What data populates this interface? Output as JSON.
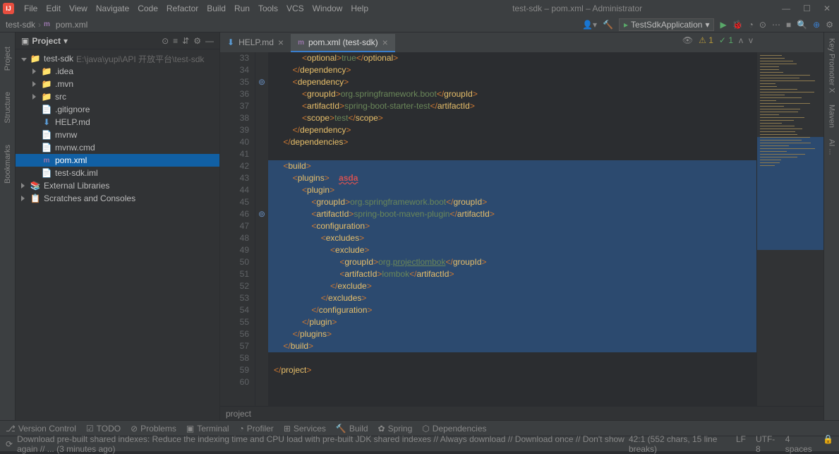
{
  "title": "test-sdk – pom.xml – Administrator",
  "menu": [
    "File",
    "Edit",
    "View",
    "Navigate",
    "Code",
    "Refactor",
    "Build",
    "Run",
    "Tools",
    "VCS",
    "Window",
    "Help"
  ],
  "breadcrumb": {
    "root": "test-sdk",
    "file": "pom.xml",
    "fileIcon": "m"
  },
  "runConfig": "TestSdkApplication",
  "leftRail": [
    "Project",
    "Structure",
    "Bookmarks"
  ],
  "rightRail": [
    "Key Promoter X",
    "Maven",
    "AI ..."
  ],
  "panel": {
    "title": "Project"
  },
  "tree": [
    {
      "label": "test-sdk",
      "path": "E:\\java\\yupi\\API 开放平台\\test-sdk",
      "icon": "folder-root",
      "indent": 0,
      "expandable": true,
      "expanded": true
    },
    {
      "label": ".idea",
      "icon": "folder",
      "indent": 1,
      "expandable": true,
      "expanded": false
    },
    {
      "label": ".mvn",
      "icon": "folder",
      "indent": 1,
      "expandable": true,
      "expanded": false
    },
    {
      "label": "src",
      "icon": "folder",
      "indent": 1,
      "expandable": true,
      "expanded": false
    },
    {
      "label": ".gitignore",
      "icon": "file",
      "indent": 1
    },
    {
      "label": "HELP.md",
      "icon": "md",
      "indent": 1
    },
    {
      "label": "mvnw",
      "icon": "file",
      "indent": 1
    },
    {
      "label": "mvnw.cmd",
      "icon": "file",
      "indent": 1
    },
    {
      "label": "pom.xml",
      "icon": "maven",
      "indent": 1,
      "selected": true
    },
    {
      "label": "test-sdk.iml",
      "icon": "file",
      "indent": 1
    },
    {
      "label": "External Libraries",
      "icon": "lib",
      "indent": 0,
      "expandable": true,
      "expanded": false
    },
    {
      "label": "Scratches and Consoles",
      "icon": "scratch",
      "indent": 0,
      "expandable": true,
      "expanded": false
    }
  ],
  "tabs": [
    {
      "label": "HELP.md",
      "active": false,
      "icon": "md"
    },
    {
      "label": "pom.xml (test-sdk)",
      "active": true,
      "icon": "maven"
    }
  ],
  "editorStatus": {
    "warn": "1",
    "ok": "1"
  },
  "bottomTools": [
    "Version Control",
    "TODO",
    "Problems",
    "Terminal",
    "Profiler",
    "Services",
    "Build",
    "Spring",
    "Dependencies"
  ],
  "statusMsg": "Download pre-built shared indexes: Reduce the indexing time and CPU load with pre-built JDK shared indexes // Always download // Download once // Don't show again // ... (3 minutes ago)",
  "statusRight": {
    "pos": "42:1 (552 chars, 15 line breaks)",
    "lf": "LF",
    "enc": "UTF-8",
    "indent": "4 spaces"
  },
  "breadcrumbBottom": "project",
  "code": [
    {
      "n": 33,
      "gi": "",
      "sel": false,
      "html": "            <span class='t'>&lt;</span><span class='tn'>optional</span><span class='t'>&gt;</span><span class='tx'>true</span><span class='t'>&lt;/</span><span class='tn'>optional</span><span class='t'>&gt;</span>"
    },
    {
      "n": 34,
      "gi": "",
      "sel": false,
      "html": "        <span class='t'>&lt;/</span><span class='tn'>dependency</span><span class='t'>&gt;</span>"
    },
    {
      "n": 35,
      "gi": "⊚",
      "sel": false,
      "html": "        <span class='t'>&lt;</span><span class='tn'>dependency</span><span class='t'>&gt;</span>"
    },
    {
      "n": 36,
      "gi": "",
      "sel": false,
      "html": "            <span class='t'>&lt;</span><span class='tn'>groupId</span><span class='t'>&gt;</span><span class='tx'>org.springframework.boot</span><span class='t'>&lt;/</span><span class='tn'>groupId</span><span class='t'>&gt;</span>"
    },
    {
      "n": 37,
      "gi": "",
      "sel": false,
      "html": "            <span class='t'>&lt;</span><span class='tn'>artifactId</span><span class='t'>&gt;</span><span class='tx'>spring-boot-starter-test</span><span class='t'>&lt;/</span><span class='tn'>artifactId</span><span class='t'>&gt;</span>"
    },
    {
      "n": 38,
      "gi": "",
      "sel": false,
      "html": "            <span class='t'>&lt;</span><span class='tn'>scope</span><span class='t'>&gt;</span><span class='tx'>test</span><span class='t'>&lt;/</span><span class='tn'>scope</span><span class='t'>&gt;</span>"
    },
    {
      "n": 39,
      "gi": "",
      "sel": false,
      "html": "        <span class='t'>&lt;/</span><span class='tn'>dependency</span><span class='t'>&gt;</span>"
    },
    {
      "n": 40,
      "gi": "",
      "sel": false,
      "html": "    <span class='t'>&lt;/</span><span class='tn'>dependencies</span><span class='t'>&gt;</span>"
    },
    {
      "n": 41,
      "gi": "",
      "sel": false,
      "html": ""
    },
    {
      "n": 42,
      "gi": "",
      "sel": true,
      "html": "    <span class='t'>&lt;</span><span class='tn'>build</span><span class='t'>&gt;</span>"
    },
    {
      "n": 43,
      "gi": "",
      "sel": true,
      "html": "        <span class='t'>&lt;</span><span class='tn'>plugins</span><span class='t'>&gt;</span>    <span class='err'>asda</span>"
    },
    {
      "n": 44,
      "gi": "",
      "sel": true,
      "html": "            <span class='t'>&lt;</span><span class='tn'>plugin</span><span class='t'>&gt;</span>"
    },
    {
      "n": 45,
      "gi": "",
      "sel": true,
      "html": "                <span class='t'>&lt;</span><span class='tn'>groupId</span><span class='t'>&gt;</span><span class='tx'>org.springframework.boot</span><span class='t'>&lt;/</span><span class='tn'>groupId</span><span class='t'>&gt;</span>"
    },
    {
      "n": 46,
      "gi": "⊚",
      "sel": true,
      "html": "                <span class='t'>&lt;</span><span class='tn'>artifactId</span><span class='t'>&gt;</span><span class='tx'>spring-boot-maven-plugin</span><span class='t'>&lt;/</span><span class='tn'>artifactId</span><span class='t'>&gt;</span>"
    },
    {
      "n": 47,
      "gi": "",
      "sel": true,
      "html": "                <span class='t'>&lt;</span><span class='tn'>configuration</span><span class='t'>&gt;</span>"
    },
    {
      "n": 48,
      "gi": "",
      "sel": true,
      "html": "                    <span class='t'>&lt;</span><span class='tn'>excludes</span><span class='t'>&gt;</span>"
    },
    {
      "n": 49,
      "gi": "",
      "sel": true,
      "html": "                        <span class='t'>&lt;</span><span class='tn'>exclude</span><span class='t'>&gt;</span>"
    },
    {
      "n": 50,
      "gi": "",
      "sel": true,
      "html": "                            <span class='t'>&lt;</span><span class='tn'>groupId</span><span class='t'>&gt;</span><span class='tx'>org.<span class='underline'>projectlombok</span></span><span class='t'>&lt;/</span><span class='tn'>groupId</span><span class='t'>&gt;</span>"
    },
    {
      "n": 51,
      "gi": "",
      "sel": true,
      "html": "                            <span class='t'>&lt;</span><span class='tn'>artifactId</span><span class='t'>&gt;</span><span class='tx'>lombok</span><span class='t'>&lt;/</span><span class='tn'>artifactId</span><span class='t'>&gt;</span>"
    },
    {
      "n": 52,
      "gi": "",
      "sel": true,
      "html": "                        <span class='t'>&lt;/</span><span class='tn'>exclude</span><span class='t'>&gt;</span>"
    },
    {
      "n": 53,
      "gi": "",
      "sel": true,
      "html": "                    <span class='t'>&lt;/</span><span class='tn'>excludes</span><span class='t'>&gt;</span>"
    },
    {
      "n": 54,
      "gi": "",
      "sel": true,
      "html": "                <span class='t'>&lt;/</span><span class='tn'>configuration</span><span class='t'>&gt;</span>"
    },
    {
      "n": 55,
      "gi": "",
      "sel": true,
      "html": "            <span class='t'>&lt;/</span><span class='tn'>plugin</span><span class='t'>&gt;</span>"
    },
    {
      "n": 56,
      "gi": "",
      "sel": true,
      "html": "        <span class='t'>&lt;/</span><span class='tn'>plugins</span><span class='t'>&gt;</span>"
    },
    {
      "n": 57,
      "gi": "",
      "sel": true,
      "html": "    <span class='t'>&lt;/</span><span class='tn'>build</span><span class='t'>&gt;</span>"
    },
    {
      "n": 58,
      "gi": "",
      "sel": false,
      "html": ""
    },
    {
      "n": 59,
      "gi": "",
      "sel": false,
      "html": "<span class='t'>&lt;/</span><span class='tn'>project</span><span class='t'>&gt;</span>"
    },
    {
      "n": 60,
      "gi": "",
      "sel": false,
      "html": ""
    }
  ]
}
